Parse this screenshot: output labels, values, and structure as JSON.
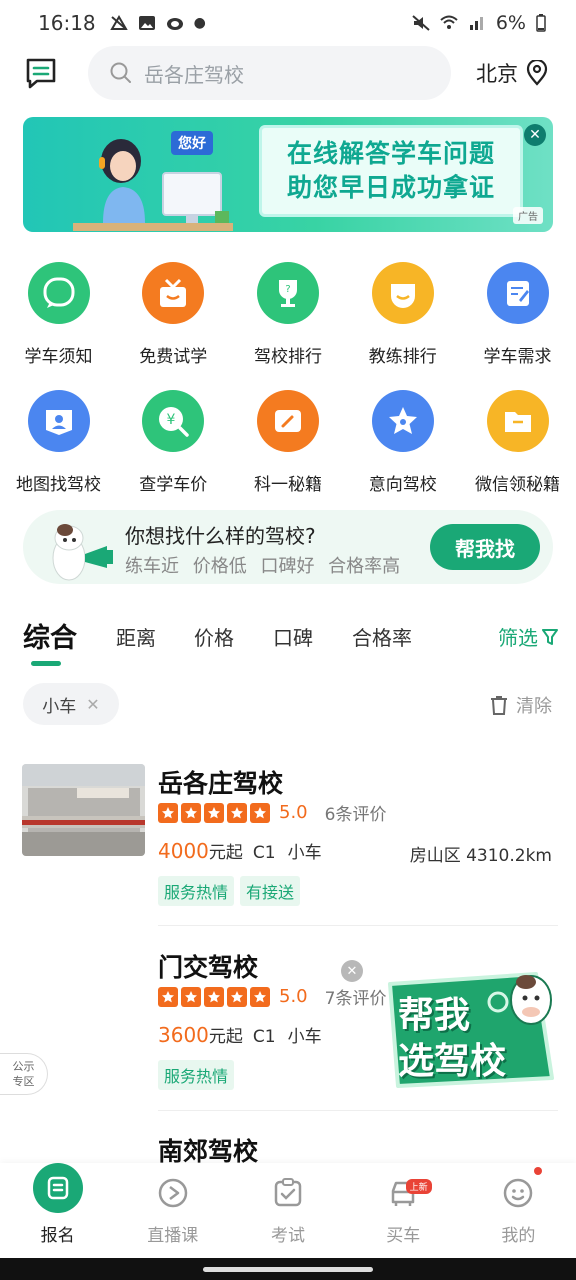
{
  "status_bar": {
    "time": "16:18",
    "battery": "6%"
  },
  "header": {
    "search_placeholder": "岳各庄驾校",
    "city": "北京"
  },
  "banner": {
    "hello": "您好",
    "line1": "在线解答学车问题",
    "line2": "助您早日成功拿证",
    "ad_label": "广告"
  },
  "grid": {
    "row1": [
      {
        "label": "学车须知",
        "color": "#2ec47a"
      },
      {
        "label": "免费试学",
        "color": "#f47b20"
      },
      {
        "label": "驾校排行",
        "color": "#2ec47a"
      },
      {
        "label": "教练排行",
        "color": "#f7b526"
      },
      {
        "label": "学车需求",
        "color": "#4b86f0"
      }
    ],
    "row2": [
      {
        "label": "地图找驾校",
        "color": "#4b86f0"
      },
      {
        "label": "查学车价",
        "color": "#2ec47a"
      },
      {
        "label": "科一秘籍",
        "color": "#f47b20"
      },
      {
        "label": "意向驾校",
        "color": "#4b86f0"
      },
      {
        "label": "微信领秘籍",
        "color": "#f7b526"
      }
    ]
  },
  "finder": {
    "title": "你想找什么样的驾校?",
    "tags": "练车近 价格低 口碑好 合格率高",
    "button": "帮我找"
  },
  "sort_tabs": {
    "tab1": "综合",
    "tab2": "距离",
    "tab3": "价格",
    "tab4": "口碑",
    "tab5": "合格率",
    "filter": "筛选"
  },
  "filter_chip": {
    "label": "小车",
    "clear": "清除"
  },
  "schools": [
    {
      "name": "岳各庄驾校",
      "rating": "5.0",
      "reviews": "6条评价",
      "price": "4000",
      "price_suffix": "元起",
      "license": "C1",
      "car": "小车",
      "location": "房山区 4310.2km",
      "badges": [
        "服务热情",
        "有接送"
      ]
    },
    {
      "name": "门交驾校",
      "rating": "5.0",
      "reviews": "7条评价",
      "price": "3600",
      "price_suffix": "元起",
      "license": "C1",
      "car": "小车",
      "badges": [
        "服务热情"
      ]
    },
    {
      "name": "南郊驾校"
    }
  ],
  "float": {
    "line1": "帮我",
    "line2": "选驾校",
    "public_zone_1": "公示",
    "public_zone_2": "专区"
  },
  "bottom_nav": [
    {
      "label": "报名"
    },
    {
      "label": "直播课"
    },
    {
      "label": "考试"
    },
    {
      "label": "买车",
      "badge": "上新"
    },
    {
      "label": "我的"
    }
  ],
  "colors": {
    "brand": "#1aa876",
    "accent": "#f26b1d"
  }
}
